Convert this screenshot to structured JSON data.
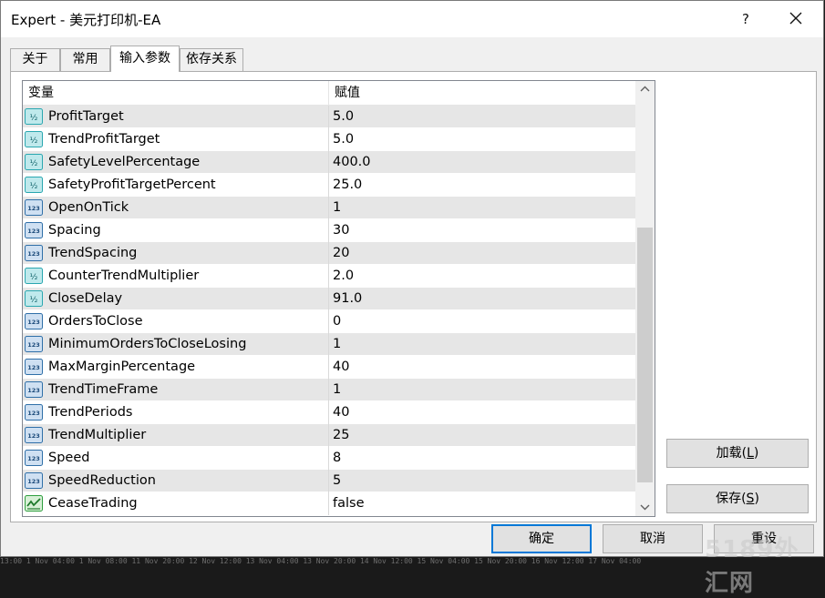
{
  "window": {
    "title": "Expert - 美元打印机-EA",
    "help_label": "?"
  },
  "tabs": [
    {
      "label": "关于"
    },
    {
      "label": "常用"
    },
    {
      "label": "输入参数"
    },
    {
      "label": "依存关系"
    }
  ],
  "grid": {
    "headers": {
      "variable": "变量",
      "value": "赋值"
    },
    "rows": [
      {
        "name": "ProfitTarget",
        "value": "5.0",
        "icon": "double-type-icon"
      },
      {
        "name": "TrendProfitTarget",
        "value": "5.0",
        "icon": "double-type-icon"
      },
      {
        "name": "SafetyLevelPercentage",
        "value": "400.0",
        "icon": "double-type-icon"
      },
      {
        "name": "SafetyProfitTargetPercent",
        "value": "25.0",
        "icon": "double-type-icon"
      },
      {
        "name": "OpenOnTick",
        "value": "1",
        "icon": "integer-type-icon"
      },
      {
        "name": "Spacing",
        "value": "30",
        "icon": "integer-type-icon"
      },
      {
        "name": "TrendSpacing",
        "value": "20",
        "icon": "integer-type-icon"
      },
      {
        "name": "CounterTrendMultiplier",
        "value": "2.0",
        "icon": "double-type-icon"
      },
      {
        "name": "CloseDelay",
        "value": "91.0",
        "icon": "double-type-icon"
      },
      {
        "name": "OrdersToClose",
        "value": "0",
        "icon": "integer-type-icon"
      },
      {
        "name": "MinimumOrdersToCloseLosing",
        "value": "1",
        "icon": "integer-type-icon"
      },
      {
        "name": "MaxMarginPercentage",
        "value": "40",
        "icon": "integer-type-icon"
      },
      {
        "name": "TrendTimeFrame",
        "value": "1",
        "icon": "integer-type-icon"
      },
      {
        "name": "TrendPeriods",
        "value": "40",
        "icon": "integer-type-icon"
      },
      {
        "name": "TrendMultiplier",
        "value": "25",
        "icon": "integer-type-icon"
      },
      {
        "name": "Speed",
        "value": "8",
        "icon": "integer-type-icon"
      },
      {
        "name": "SpeedReduction",
        "value": "5",
        "icon": "integer-type-icon"
      },
      {
        "name": "CeaseTrading",
        "value": "false",
        "icon": "boolean-type-icon"
      }
    ]
  },
  "side_buttons": {
    "load_label": "加载(",
    "load_key": "L",
    "load_close": ")",
    "save_label": "保存(",
    "save_key": "S",
    "save_close": ")"
  },
  "bottom_buttons": {
    "ok_label": "确定",
    "cancel_label": "取消",
    "reset_label": "重设"
  },
  "watermark": "5189外汇网",
  "background_strip": "13:00   1 Nov 04:00   1 Nov 08:00   11 Nov 20:00   12 Nov 12:00   13 Nov 04:00   13 Nov 20:00   14 Nov 12:00   15 Nov 04:00   15 Nov 20:00   16 Nov 12:00   17 Nov 04:00",
  "colors": {
    "dialog_bg": "#f0f0f0",
    "alt_row": "#e6e6e6",
    "default_button_border": "#0078d7",
    "double_icon": "#4fc3c8",
    "integer_icon": "#2f6fa8",
    "boolean_icon": "#2e9e3e"
  }
}
